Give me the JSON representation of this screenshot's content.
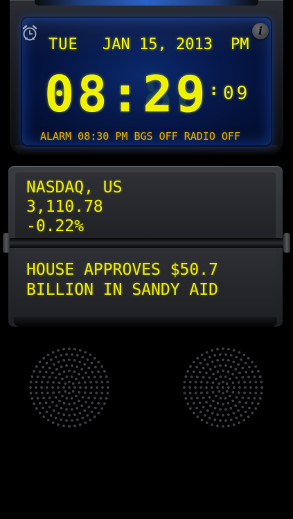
{
  "clock": {
    "day": "TUE",
    "date": "JAN 15, 2013",
    "ampm": "PM",
    "time": "08:29",
    "time_ghost": "88:88",
    "seconds": "09",
    "status": "ALARM 08:30 PM BGS OFF RADIO OFF"
  },
  "icons": {
    "alarm": "alarm-clock-icon",
    "info": "info-icon",
    "info_glyph": "i"
  },
  "news": {
    "stock_name": "NASDAQ, US",
    "stock_value": "3,110.78",
    "stock_change": "-0.22%",
    "headline_line1": "HOUSE APPROVES $50.7",
    "headline_line2": "BILLION IN SANDY AID"
  },
  "colors": {
    "lcd_yellow": "#f0f100",
    "screen_blue": "#06184a",
    "glow_blue": "#2b62c9"
  }
}
